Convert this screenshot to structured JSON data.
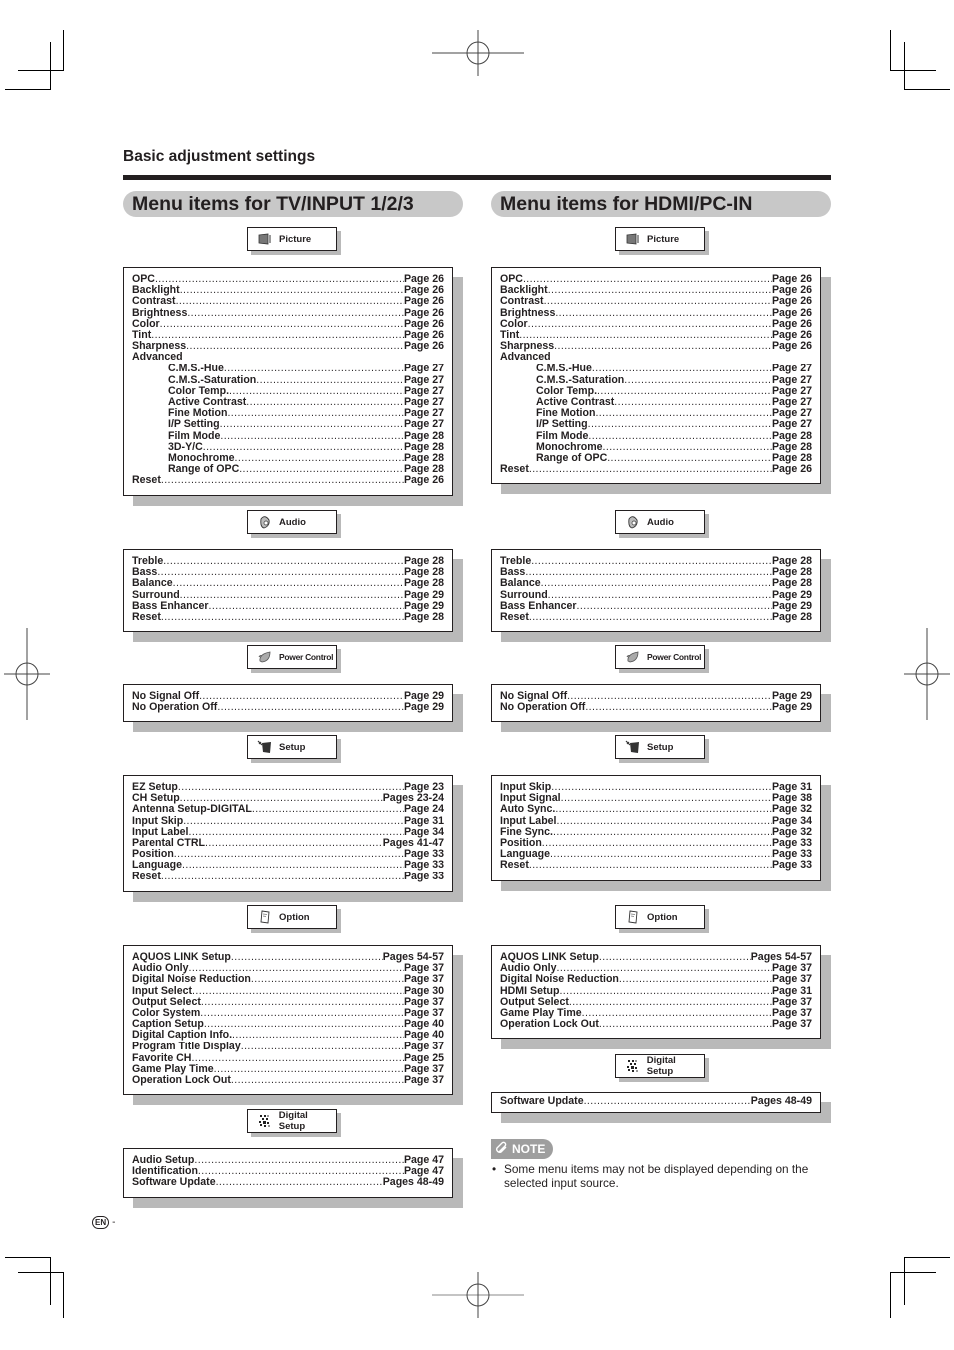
{
  "section_heading": "Basic adjustment settings",
  "columns": [
    {
      "title": "Menu items for TV/INPUT 1/2/3",
      "groups": [
        {
          "tab": {
            "label": "Picture",
            "icon": "picture-icon"
          },
          "items": [
            {
              "label": "OPC",
              "page": "Page 26"
            },
            {
              "label": "Backlight",
              "page": "Page 26"
            },
            {
              "label": "Contrast",
              "page": "Page 26"
            },
            {
              "label": "Brightness",
              "page": "Page 26"
            },
            {
              "label": "Color",
              "page": "Page 26"
            },
            {
              "label": "Tint",
              "page": "Page 26"
            },
            {
              "label": "Sharpness",
              "page": "Page 26"
            },
            {
              "label": "Advanced",
              "page": ""
            },
            {
              "label": "C.M.S.-Hue",
              "page": "Page 27",
              "indent": true
            },
            {
              "label": "C.M.S.-Saturation",
              "page": "Page 27",
              "indent": true
            },
            {
              "label": "Color Temp.",
              "page": "Page 27",
              "indent": true
            },
            {
              "label": "Active Contrast",
              "page": "Page 27",
              "indent": true
            },
            {
              "label": "Fine Motion",
              "page": "Page 27",
              "indent": true
            },
            {
              "label": "I/P Setting",
              "page": "Page 27",
              "indent": true
            },
            {
              "label": "Film Mode",
              "page": "Page 28",
              "indent": true
            },
            {
              "label": "3D-Y/C",
              "page": "Page 28",
              "indent": true
            },
            {
              "label": "Monochrome",
              "page": "Page 28",
              "indent": true
            },
            {
              "label": "Range of OPC",
              "page": "Page 28",
              "indent": true
            },
            {
              "label": "Reset",
              "page": "Page 26"
            }
          ]
        },
        {
          "tab": {
            "label": "Audio",
            "icon": "speaker-icon"
          },
          "items": [
            {
              "label": "Treble",
              "page": "Page 28"
            },
            {
              "label": "Bass",
              "page": "Page 28"
            },
            {
              "label": "Balance",
              "page": "Page 28"
            },
            {
              "label": "Surround",
              "page": "Page 29"
            },
            {
              "label": "Bass Enhancer",
              "page": "Page 29"
            },
            {
              "label": "Reset",
              "page": "Page 28"
            }
          ]
        },
        {
          "tab": {
            "label": "Power Control",
            "icon": "leaf-icon"
          },
          "items": [
            {
              "label": "No Signal Off",
              "page": "Page 29"
            },
            {
              "label": "No Operation Off",
              "page": "Page 29"
            }
          ]
        },
        {
          "tab": {
            "label": "Setup",
            "icon": "setup-icon"
          },
          "items": [
            {
              "label": "EZ Setup",
              "page": "Page 23"
            },
            {
              "label": "CH Setup",
              "page": "Pages 23-24"
            },
            {
              "label": "Antenna Setup-DIGITAL",
              "page": "Page 24"
            },
            {
              "label": "Input Skip",
              "page": "Page 31"
            },
            {
              "label": "Input Label",
              "page": "Page 34"
            },
            {
              "label": "Parental CTRL",
              "page": "Pages 41-47"
            },
            {
              "label": "Position",
              "page": "Page 33"
            },
            {
              "label": "Language",
              "page": "Page 33"
            },
            {
              "label": "Reset",
              "page": "Page 33"
            }
          ]
        },
        {
          "tab": {
            "label": "Option",
            "icon": "option-icon"
          },
          "items": [
            {
              "label": "AQUOS LINK Setup",
              "page": "Pages 54-57"
            },
            {
              "label": "Audio Only",
              "page": "Page 37"
            },
            {
              "label": "Digital Noise Reduction",
              "page": "Page 37"
            },
            {
              "label": "Input Select",
              "page": "Page 30"
            },
            {
              "label": "Output Select",
              "page": "Page 37"
            },
            {
              "label": "Color System",
              "page": "Page 37"
            },
            {
              "label": "Caption Setup",
              "page": "Page 40"
            },
            {
              "label": "Digital Caption Info.",
              "page": "Page 40"
            },
            {
              "label": "Program Title Display",
              "page": "Page 37"
            },
            {
              "label": "Favorite CH",
              "page": "Page 25"
            },
            {
              "label": "Game Play Time",
              "page": "Page 37"
            },
            {
              "label": "Operation Lock Out",
              "page": "Page 37"
            }
          ]
        },
        {
          "tab": {
            "label": "Digital Setup",
            "icon": "digital-setup-icon"
          },
          "items": [
            {
              "label": "Audio Setup",
              "page": "Page 47"
            },
            {
              "label": "Identification",
              "page": "Page 47"
            },
            {
              "label": "Software Update",
              "page": "Pages 48-49"
            }
          ]
        }
      ]
    },
    {
      "title": "Menu items for HDMI/PC-IN",
      "groups": [
        {
          "tab": {
            "label": "Picture",
            "icon": "picture-icon"
          },
          "items": [
            {
              "label": "OPC",
              "page": "Page 26"
            },
            {
              "label": "Backlight",
              "page": "Page 26"
            },
            {
              "label": "Contrast",
              "page": "Page 26"
            },
            {
              "label": "Brightness",
              "page": "Page 26"
            },
            {
              "label": "Color",
              "page": "Page 26"
            },
            {
              "label": "Tint",
              "page": "Page 26"
            },
            {
              "label": "Sharpness",
              "page": "Page 26"
            },
            {
              "label": "Advanced",
              "page": ""
            },
            {
              "label": "C.M.S.-Hue",
              "page": "Page 27",
              "indent": true
            },
            {
              "label": "C.M.S.-Saturation",
              "page": "Page 27",
              "indent": true
            },
            {
              "label": "Color Temp.",
              "page": "Page 27",
              "indent": true
            },
            {
              "label": "Active Contrast",
              "page": "Page 27",
              "indent": true
            },
            {
              "label": "Fine Motion",
              "page": "Page 27",
              "indent": true
            },
            {
              "label": "I/P Setting",
              "page": "Page 27",
              "indent": true
            },
            {
              "label": "Film Mode",
              "page": "Page 28",
              "indent": true
            },
            {
              "label": "Monochrome",
              "page": "Page 28",
              "indent": true
            },
            {
              "label": "Range of OPC",
              "page": "Page 28",
              "indent": true
            },
            {
              "label": "Reset",
              "page": "Page 26"
            }
          ]
        },
        {
          "tab": {
            "label": "Audio",
            "icon": "speaker-icon"
          },
          "items": [
            {
              "label": "Treble",
              "page": "Page 28"
            },
            {
              "label": "Bass",
              "page": "Page 28"
            },
            {
              "label": "Balance",
              "page": "Page 28"
            },
            {
              "label": "Surround",
              "page": "Page 29"
            },
            {
              "label": "Bass Enhancer",
              "page": "Page 29"
            },
            {
              "label": "Reset",
              "page": "Page 28"
            }
          ]
        },
        {
          "tab": {
            "label": "Power Control",
            "icon": "leaf-icon"
          },
          "items": [
            {
              "label": "No Signal Off",
              "page": "Page 29"
            },
            {
              "label": "No Operation Off",
              "page": "Page 29"
            }
          ]
        },
        {
          "tab": {
            "label": "Setup",
            "icon": "setup-icon"
          },
          "items": [
            {
              "label": "Input Skip",
              "page": "Page 31"
            },
            {
              "label": "Input Signal",
              "page": "Page 38"
            },
            {
              "label": "Auto Sync.",
              "page": "Page 32"
            },
            {
              "label": "Input Label",
              "page": "Page 34"
            },
            {
              "label": "Fine Sync.",
              "page": "Page 32"
            },
            {
              "label": "Position",
              "page": "Page 33"
            },
            {
              "label": "Language",
              "page": "Page 33"
            },
            {
              "label": "Reset",
              "page": "Page 33"
            }
          ]
        },
        {
          "tab": {
            "label": "Option",
            "icon": "option-icon"
          },
          "items": [
            {
              "label": "AQUOS LINK Setup",
              "page": "Pages 54-57"
            },
            {
              "label": "Audio Only",
              "page": "Page 37"
            },
            {
              "label": "Digital Noise Reduction",
              "page": "Page 37"
            },
            {
              "label": "HDMI Setup",
              "page": "Page 31"
            },
            {
              "label": "Output Select",
              "page": "Page 37"
            },
            {
              "label": "Game Play Time",
              "page": "Page 37"
            },
            {
              "label": "Operation Lock Out",
              "page": "Page 37"
            }
          ]
        },
        {
          "tab": {
            "label": "Digital Setup",
            "icon": "digital-setup-icon"
          },
          "items": [
            {
              "label": "Software Update",
              "page": "Pages 48-49"
            }
          ]
        }
      ]
    }
  ],
  "note": {
    "label": "NOTE",
    "items": [
      "Some menu items may not be displayed depending on the selected input source."
    ]
  },
  "footer": {
    "language_badge": "EN",
    "page_suffix": "-"
  },
  "colors": {
    "title_pill": "#c8c8c8",
    "shadow": "#b9b9b9",
    "text": "#231f20",
    "note_badge": "#9e9e9e"
  }
}
